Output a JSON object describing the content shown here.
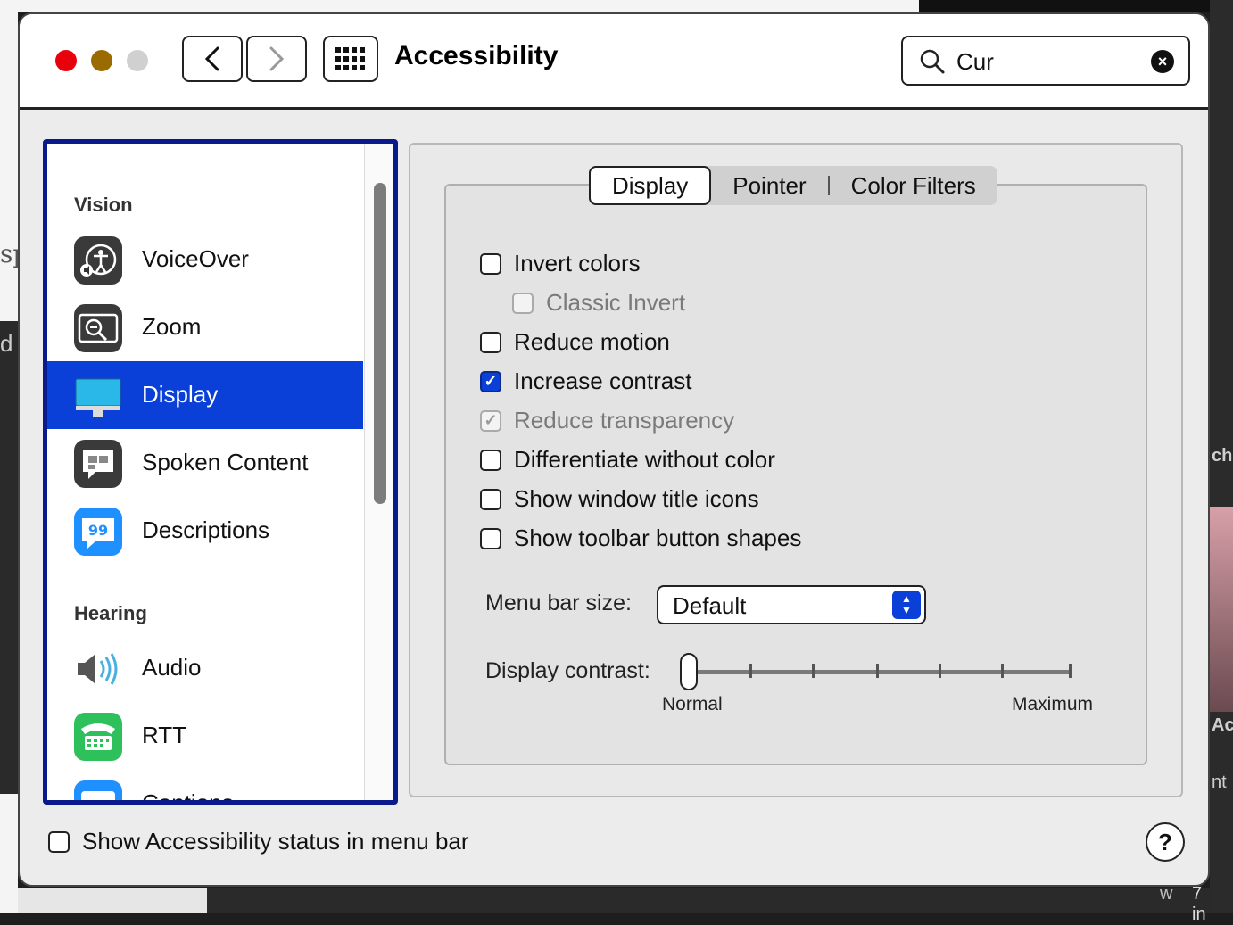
{
  "window": {
    "title": "Accessibility"
  },
  "search": {
    "value": "Cur"
  },
  "sidebar": {
    "sections": [
      {
        "heading": "Vision",
        "items": [
          {
            "label": "VoiceOver",
            "icon": "voiceover-icon"
          },
          {
            "label": "Zoom",
            "icon": "zoom-icon"
          },
          {
            "label": "Display",
            "icon": "display-icon",
            "selected": true
          },
          {
            "label": "Spoken Content",
            "icon": "spoken-content-icon"
          },
          {
            "label": "Descriptions",
            "icon": "descriptions-icon"
          }
        ]
      },
      {
        "heading": "Hearing",
        "items": [
          {
            "label": "Audio",
            "icon": "audio-icon"
          },
          {
            "label": "RTT",
            "icon": "rtt-icon"
          },
          {
            "label": "Captions",
            "icon": "captions-icon"
          }
        ]
      }
    ]
  },
  "tabs": [
    "Display",
    "Pointer",
    "Color Filters"
  ],
  "active_tab": "Display",
  "options": [
    {
      "label": "Invert colors",
      "checked": false,
      "enabled": true
    },
    {
      "label": "Classic Invert",
      "checked": false,
      "enabled": false
    },
    {
      "label": "Reduce motion",
      "checked": false,
      "enabled": true
    },
    {
      "label": "Increase contrast",
      "checked": true,
      "enabled": true
    },
    {
      "label": "Reduce transparency",
      "checked": true,
      "enabled": false
    },
    {
      "label": "Differentiate without color",
      "checked": false,
      "enabled": true
    },
    {
      "label": "Show window title icons",
      "checked": false,
      "enabled": true
    },
    {
      "label": "Show toolbar button shapes",
      "checked": false,
      "enabled": true
    }
  ],
  "menu_bar_size": {
    "label": "Menu bar size:",
    "value": "Default"
  },
  "display_contrast": {
    "label": "Display contrast:",
    "min_label": "Normal",
    "max_label": "Maximum",
    "value": 0
  },
  "status_checkbox": {
    "label": "Show Accessibility status in menu bar",
    "checked": false
  },
  "help_label": "?",
  "background_fragments": {
    "left1": "sp",
    "left2": "d",
    "right1": "ch",
    "right2": "Ac",
    "right3": "nt",
    "bottom1": "w",
    "bottom2": "7 in"
  },
  "colors": {
    "accent": "#0a40d8",
    "sidebar_border": "#0a1a8a",
    "close": "#e8000c",
    "minimize": "#9a6b00",
    "zoom": "#d0d0d0"
  }
}
